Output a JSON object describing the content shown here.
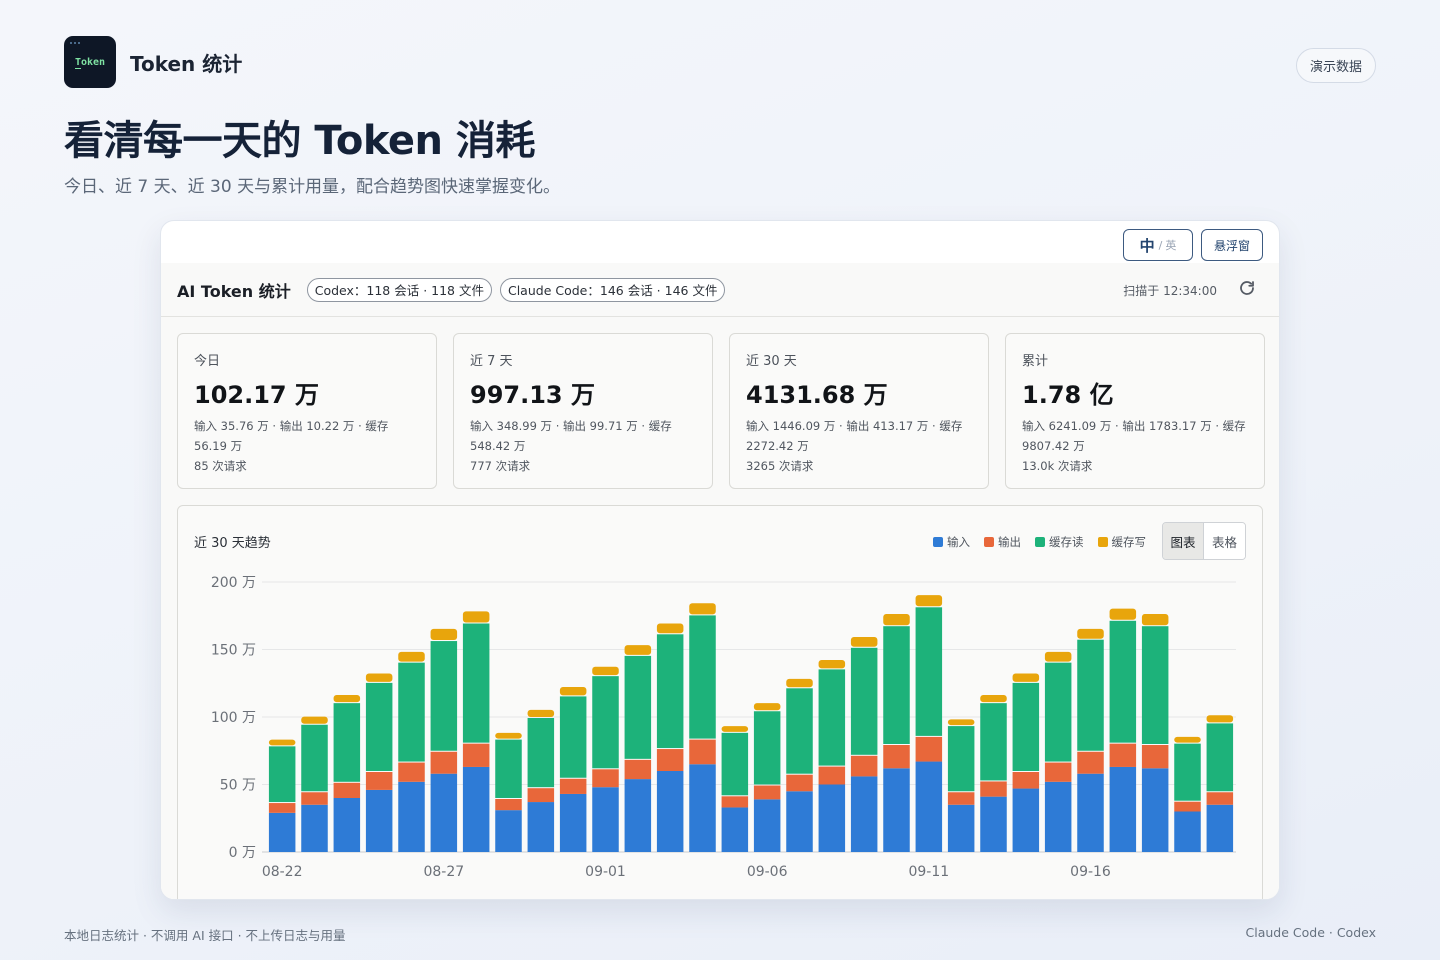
{
  "app": {
    "logo_text": "Token",
    "title": "Token 统计"
  },
  "header": {
    "demo_button": "演示数据"
  },
  "hero": {
    "title": "看清每一天的 Token 消耗",
    "subtitle": "今日、近 7 天、近 30 天与累计用量，配合趋势图快速掌握变化。"
  },
  "panel": {
    "lang": {
      "zh": "中",
      "sep": "/",
      "en": "英"
    },
    "float_button": "悬浮窗",
    "title": "AI Token 统计",
    "pills": [
      "Codex：118 会话 · 118 文件",
      "Claude Code：146 会话 · 146 文件"
    ],
    "scan_time": "扫描于 12:34:00",
    "refresh_icon": "refresh-icon"
  },
  "cards": [
    {
      "label": "今日",
      "value": "102.17 万",
      "detail": "输入 35.76 万 · 输出 10.22 万 · 缓存 56.19 万",
      "requests": "85 次请求"
    },
    {
      "label": "近 7 天",
      "value": "997.13 万",
      "detail": "输入 348.99 万 · 输出 99.71 万 · 缓存 548.42 万",
      "requests": "777 次请求"
    },
    {
      "label": "近 30 天",
      "value": "4131.68 万",
      "detail": "输入 1446.09 万 · 输出 413.17 万 · 缓存 2272.42 万",
      "requests": "3265 次请求"
    },
    {
      "label": "累计",
      "value": "1.78 亿",
      "detail": "输入 6241.09 万 · 输出 1783.17 万 · 缓存 9807.42 万",
      "requests": "13.0k 次请求"
    }
  ],
  "trend": {
    "title": "近 30 天趋势",
    "toggle": {
      "chart": "图表",
      "table": "表格",
      "selected": "图表"
    }
  },
  "colors": {
    "input": "#2e7bd6",
    "output": "#e8673a",
    "cache_read": "#1db27a",
    "cache_write": "#e8a50c"
  },
  "chart_data": {
    "type": "bar",
    "stacked": true,
    "ylim": [
      0,
      200
    ],
    "yticks": [
      "0 万",
      "50 万",
      "100 万",
      "150 万",
      "200 万"
    ],
    "ytick_values": [
      0,
      50,
      100,
      150,
      200
    ],
    "categories": [
      "08-22",
      "08-23",
      "08-24",
      "08-25",
      "08-26",
      "08-27",
      "08-28",
      "08-29",
      "08-30",
      "08-31",
      "09-01",
      "09-02",
      "09-03",
      "09-04",
      "09-05",
      "09-06",
      "09-07",
      "09-08",
      "09-09",
      "09-10",
      "09-11",
      "09-12",
      "09-13",
      "09-14",
      "09-15",
      "09-16",
      "09-17",
      "09-18",
      "09-19",
      "09-20"
    ],
    "xtick_labels": [
      "08-22",
      "08-27",
      "09-01",
      "09-06",
      "09-11",
      "09-16"
    ],
    "grid": true,
    "legend_position": "top-right",
    "series": [
      {
        "name": "输入",
        "color": "#2e7bd6",
        "values": [
          29,
          35,
          40,
          46,
          52,
          58,
          63,
          31,
          37,
          43,
          48,
          54,
          60,
          65,
          33,
          39,
          45,
          50,
          56,
          62,
          67,
          35,
          41,
          47,
          52,
          58,
          63,
          62,
          30,
          35
        ]
      },
      {
        "name": "输出",
        "color": "#e8673a",
        "values": [
          8,
          10,
          12,
          14,
          15,
          17,
          18,
          9,
          11,
          12,
          14,
          15,
          17,
          19,
          9,
          11,
          13,
          14,
          16,
          18,
          19,
          10,
          12,
          13,
          15,
          17,
          18,
          18,
          8,
          10
        ]
      },
      {
        "name": "缓存读",
        "color": "#1db27a",
        "values": [
          42,
          50,
          59,
          66,
          74,
          82,
          89,
          44,
          52,
          61,
          69,
          77,
          85,
          92,
          47,
          55,
          64,
          72,
          80,
          88,
          96,
          49,
          58,
          66,
          74,
          83,
          91,
          88,
          43,
          51
        ]
      },
      {
        "name": "缓存写",
        "color": "#e8a50c",
        "values": [
          5,
          6,
          6,
          7,
          8,
          9,
          9,
          5,
          6,
          7,
          7,
          8,
          8,
          9,
          5,
          6,
          7,
          7,
          8,
          9,
          9,
          5,
          6,
          7,
          8,
          8,
          9,
          9,
          5,
          6
        ]
      }
    ]
  },
  "footer": {
    "left": "本地日志统计 · 不调用 AI 接口 · 不上传日志与用量",
    "right": "Claude Code · Codex"
  }
}
